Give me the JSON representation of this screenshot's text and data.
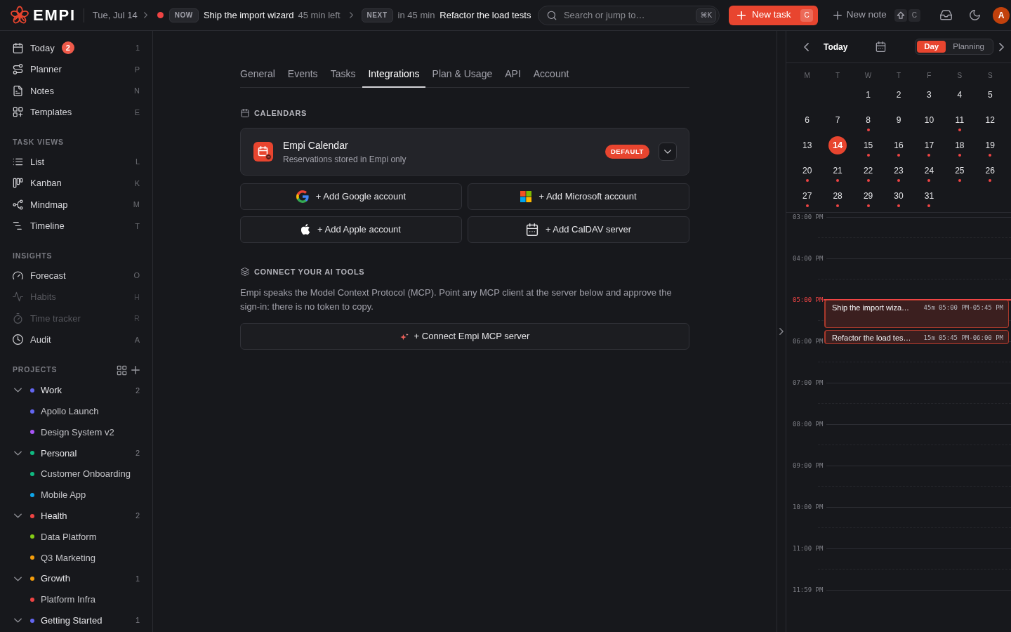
{
  "top_bar": {
    "logo": "EMPI",
    "date": "Tue, Jul 14",
    "now": {
      "badge": "NOW",
      "title": "Ship the import wizard",
      "remaining": "45 min left"
    },
    "next": {
      "badge": "NEXT",
      "when": "in 45 min",
      "title": "Refactor the load tests"
    },
    "search": {
      "placeholder": "Search or jump to…",
      "shortcut": "⌘K"
    },
    "new_task": {
      "label": "New task",
      "shortcut": "C"
    },
    "new_note": {
      "label": "New note",
      "shortcut": "C"
    },
    "avatar": "A"
  },
  "sidebar": {
    "nav": [
      {
        "label": "Today",
        "badge": "2",
        "shortcut": "1",
        "disabled": false
      },
      {
        "label": "Planner",
        "shortcut": "P",
        "disabled": false
      },
      {
        "label": "Notes",
        "shortcut": "N",
        "disabled": false
      },
      {
        "label": "Templates",
        "shortcut": "E",
        "disabled": false
      }
    ],
    "sections": [
      {
        "title": "TASK VIEWS",
        "items": [
          {
            "label": "List",
            "shortcut": "L",
            "disabled": false
          },
          {
            "label": "Kanban",
            "shortcut": "K",
            "disabled": false
          },
          {
            "label": "Mindmap",
            "shortcut": "M",
            "disabled": false
          },
          {
            "label": "Timeline",
            "shortcut": "T",
            "disabled": false
          }
        ]
      },
      {
        "title": "INSIGHTS",
        "items": [
          {
            "label": "Forecast",
            "shortcut": "O",
            "disabled": false
          },
          {
            "label": "Habits",
            "shortcut": "H",
            "disabled": true
          },
          {
            "label": "Time tracker",
            "shortcut": "R",
            "disabled": true
          },
          {
            "label": "Audit",
            "shortcut": "A",
            "disabled": false
          }
        ]
      }
    ],
    "projects": {
      "title": "PROJECTS",
      "items": [
        {
          "name": "Work",
          "color": "#6366f1",
          "count": "2",
          "expanded": true,
          "children": [
            {
              "name": "Apollo Launch",
              "color": "#6366f1"
            },
            {
              "name": "Design System v2",
              "color": "#a855f7"
            }
          ]
        },
        {
          "name": "Personal",
          "color": "#10b981",
          "count": "2",
          "expanded": true,
          "children": [
            {
              "name": "Customer Onboarding",
              "color": "#10b981"
            },
            {
              "name": "Mobile App",
              "color": "#0ea5e9"
            }
          ]
        },
        {
          "name": "Health",
          "color": "#ef4444",
          "count": "2",
          "expanded": true,
          "children": [
            {
              "name": "Data Platform",
              "color": "#84cc16"
            },
            {
              "name": "Q3 Marketing",
              "color": "#f59e0b"
            }
          ]
        },
        {
          "name": "Growth",
          "color": "#f59e0b",
          "count": "1",
          "expanded": true,
          "children": [
            {
              "name": "Platform Infra",
              "color": "#ef4444"
            }
          ]
        },
        {
          "name": "Getting Started",
          "color": "#6366f1",
          "count": "1",
          "expanded": true
        }
      ]
    }
  },
  "settings": {
    "tabs": [
      {
        "label": "General",
        "selected": false
      },
      {
        "label": "Events",
        "selected": false
      },
      {
        "label": "Tasks",
        "selected": false
      },
      {
        "label": "Integrations",
        "selected": true
      },
      {
        "label": "Plan & Usage",
        "selected": false
      },
      {
        "label": "API",
        "selected": false
      },
      {
        "label": "Account",
        "selected": false
      }
    ],
    "calendars": {
      "title": "CALENDARS",
      "accounts": [
        {
          "name": "Empi Calendar",
          "description": "Reservations stored in Empi only",
          "badge": "DEFAULT"
        }
      ],
      "add_buttons": [
        {
          "kind": "google",
          "label": "+ Add Google account"
        },
        {
          "kind": "microsoft",
          "label": "+ Add Microsoft account"
        },
        {
          "kind": "apple",
          "label": "+ Add Apple account"
        },
        {
          "kind": "caldav",
          "label": "+ Add CalDAV server"
        }
      ]
    },
    "ai_tools": {
      "title": "CONNECT YOUR AI TOOLS",
      "description": "Empi speaks the Model Context Protocol (MCP). Point any MCP client at the server below and approve the sign-in: there is no token to copy.",
      "button": "+ Connect Empi MCP server"
    }
  },
  "calendar_panel": {
    "today_button": "Today",
    "views": [
      {
        "label": "Day",
        "selected": true
      },
      {
        "label": "Planning",
        "selected": false
      }
    ],
    "weekdays": [
      "M",
      "T",
      "W",
      "T",
      "F",
      "S",
      "S"
    ],
    "days": [
      {
        "kind": "blank"
      },
      {
        "kind": "blank"
      },
      {
        "kind": "day",
        "label": "1",
        "has_events": false,
        "selected": false
      },
      {
        "kind": "day",
        "label": "2",
        "has_events": false,
        "selected": false
      },
      {
        "kind": "day",
        "label": "3",
        "has_events": false,
        "selected": false
      },
      {
        "kind": "day",
        "label": "4",
        "has_events": false,
        "selected": false
      },
      {
        "kind": "day",
        "label": "5",
        "has_events": false,
        "selected": false
      },
      {
        "kind": "day",
        "label": "6",
        "has_events": false,
        "selected": false
      },
      {
        "kind": "day",
        "label": "7",
        "has_events": false,
        "selected": false
      },
      {
        "kind": "day",
        "label": "8",
        "has_events": true,
        "selected": false
      },
      {
        "kind": "day",
        "label": "9",
        "has_events": false,
        "selected": false
      },
      {
        "kind": "day",
        "label": "10",
        "has_events": false,
        "selected": false
      },
      {
        "kind": "day",
        "label": "11",
        "has_events": true,
        "selected": false
      },
      {
        "kind": "day",
        "label": "12",
        "has_events": false,
        "selected": false
      },
      {
        "kind": "day",
        "label": "13",
        "has_events": false,
        "selected": false
      },
      {
        "kind": "day",
        "label": "14",
        "has_events": false,
        "selected": true
      },
      {
        "kind": "day",
        "label": "15",
        "has_events": true,
        "selected": false
      },
      {
        "kind": "day",
        "label": "16",
        "has_events": true,
        "selected": false
      },
      {
        "kind": "day",
        "label": "17",
        "has_events": true,
        "selected": false
      },
      {
        "kind": "day",
        "label": "18",
        "has_events": true,
        "selected": false
      },
      {
        "kind": "day",
        "label": "19",
        "has_events": true,
        "selected": false
      },
      {
        "kind": "day",
        "label": "20",
        "has_events": true,
        "selected": false
      },
      {
        "kind": "day",
        "label": "21",
        "has_events": true,
        "selected": false
      },
      {
        "kind": "day",
        "label": "22",
        "has_events": true,
        "selected": false
      },
      {
        "kind": "day",
        "label": "23",
        "has_events": true,
        "selected": false
      },
      {
        "kind": "day",
        "label": "24",
        "has_events": true,
        "selected": false
      },
      {
        "kind": "day",
        "label": "25",
        "has_events": true,
        "selected": false
      },
      {
        "kind": "day",
        "label": "26",
        "has_events": true,
        "selected": false
      },
      {
        "kind": "day",
        "label": "27",
        "has_events": true,
        "selected": false
      },
      {
        "kind": "day",
        "label": "28",
        "has_events": true,
        "selected": false
      },
      {
        "kind": "day",
        "label": "29",
        "has_events": true,
        "selected": false
      },
      {
        "kind": "day",
        "label": "30",
        "has_events": true,
        "selected": false
      },
      {
        "kind": "day",
        "label": "31",
        "has_events": true,
        "selected": false
      }
    ],
    "timeline": {
      "hours": [
        {
          "label": "03:00 PM",
          "current": false
        },
        {
          "label": "04:00 PM",
          "current": false
        },
        {
          "label": "05:00 PM",
          "current": true
        },
        {
          "label": "06:00 PM",
          "current": false
        },
        {
          "label": "07:00 PM",
          "current": false
        },
        {
          "label": "08:00 PM",
          "current": false
        },
        {
          "label": "09:00 PM",
          "current": false
        },
        {
          "label": "10:00 PM",
          "current": false
        },
        {
          "label": "11:00 PM",
          "current": false
        },
        {
          "label": "11:59 PM",
          "current": false
        }
      ],
      "events": [
        {
          "title": "Ship the import wiza…",
          "duration": "45m",
          "time": "05:00 PM-05:45 PM"
        },
        {
          "title": "Refactor the load tes…",
          "duration": "15m",
          "time": "05:45 PM-06:00 PM"
        }
      ]
    }
  }
}
